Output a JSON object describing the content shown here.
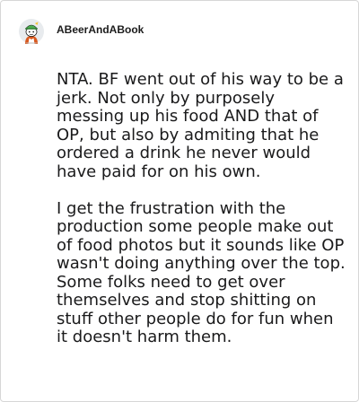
{
  "comment": {
    "author": "ABeerAndABook",
    "avatar_icon": "snoo-avatar-green-hat",
    "paragraphs": [
      "NTA. BF went out of his way to be a jerk. Not only by purposely messing up his food AND that of OP, but also by admiting that he ordered a drink he never would have paid for on his own.",
      "I get the frustration with the production some people make out of food photos but it sounds like OP wasn't doing anything over the top. Some folks need to get over themselves and stop shitting on stuff other people do for fun when it doesn't harm them."
    ]
  }
}
